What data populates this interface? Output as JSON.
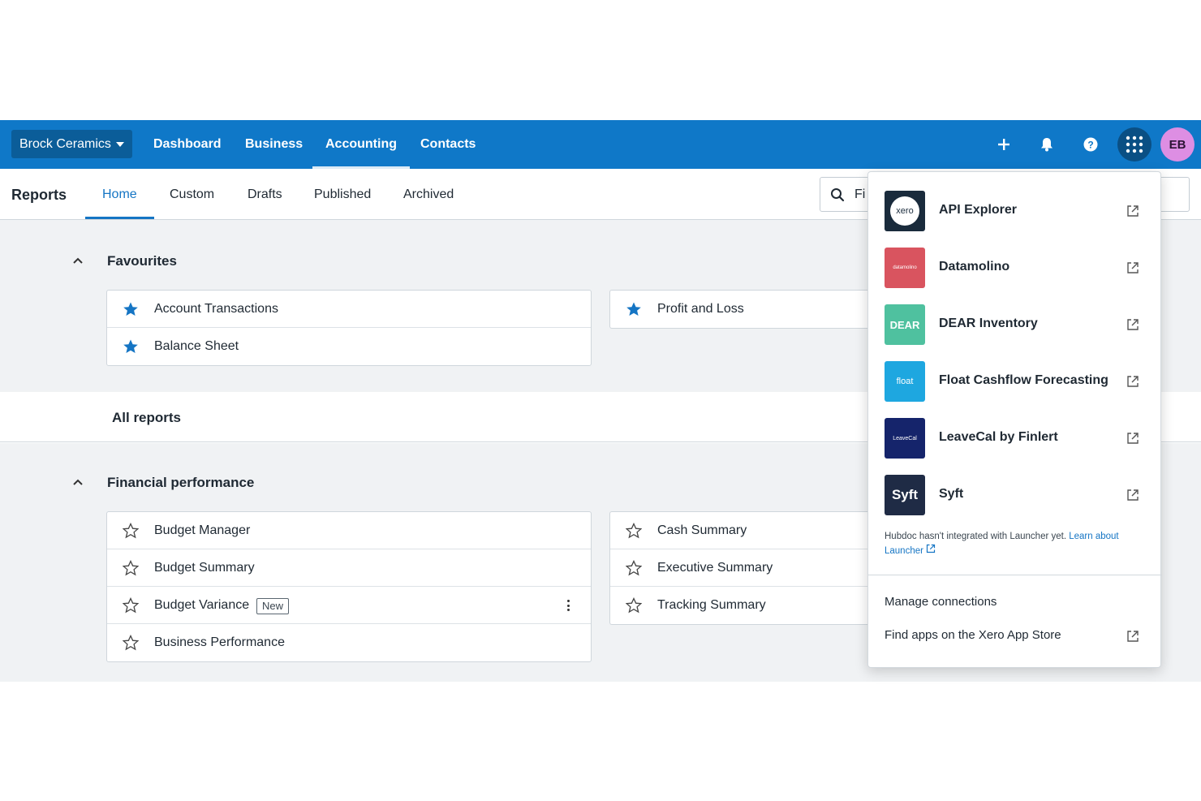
{
  "topnav": {
    "org_name": "Brock Ceramics",
    "links": [
      "Dashboard",
      "Business",
      "Accounting",
      "Contacts"
    ],
    "active_link": "Accounting",
    "avatar_initials": "EB",
    "icons": [
      "plus-icon",
      "bell-icon",
      "help-icon",
      "apps-grid-icon"
    ],
    "bar_color": "#0f78c8"
  },
  "subnav": {
    "title": "Reports",
    "tabs": [
      "Home",
      "Custom",
      "Drafts",
      "Published",
      "Archived"
    ],
    "active_tab": "Home",
    "search_value": "Fi"
  },
  "favourites": {
    "heading": "Favourites",
    "left": [
      "Account Transactions",
      "Balance Sheet"
    ],
    "right": [
      "Profit and Loss"
    ]
  },
  "all_reports": {
    "heading": "All reports"
  },
  "financial": {
    "heading": "Financial performance",
    "left": [
      {
        "label": "Budget Manager",
        "badge": ""
      },
      {
        "label": "Budget Summary",
        "badge": ""
      },
      {
        "label": "Budget Variance",
        "badge": "New"
      },
      {
        "label": "Business Performance",
        "badge": ""
      }
    ],
    "right": [
      "Cash Summary",
      "Executive Summary",
      "Tracking Summary"
    ]
  },
  "launcher": {
    "apps": [
      {
        "name": "API Explorer",
        "logo_text": "xero",
        "color": "#1a2b3c"
      },
      {
        "name": "Datamolino",
        "logo_text": "datamolino",
        "color": "#d9545f"
      },
      {
        "name": "DEAR Inventory",
        "logo_text": "DEAR",
        "color": "#4fc19f"
      },
      {
        "name": "Float Cashflow Forecasting",
        "logo_text": "float",
        "color": "#1ea7e0"
      },
      {
        "name": "LeaveCal by Finlert",
        "logo_text": "LeaveCal",
        "color": "#15246b"
      },
      {
        "name": "Syft",
        "logo_text": "Syft",
        "color": "#1f2b45"
      }
    ],
    "note_text": "Hubdoc hasn't integrated with Launcher yet.",
    "note_link": "Learn about Launcher",
    "manage_label": "Manage connections",
    "store_label": "Find apps on the Xero App Store"
  }
}
